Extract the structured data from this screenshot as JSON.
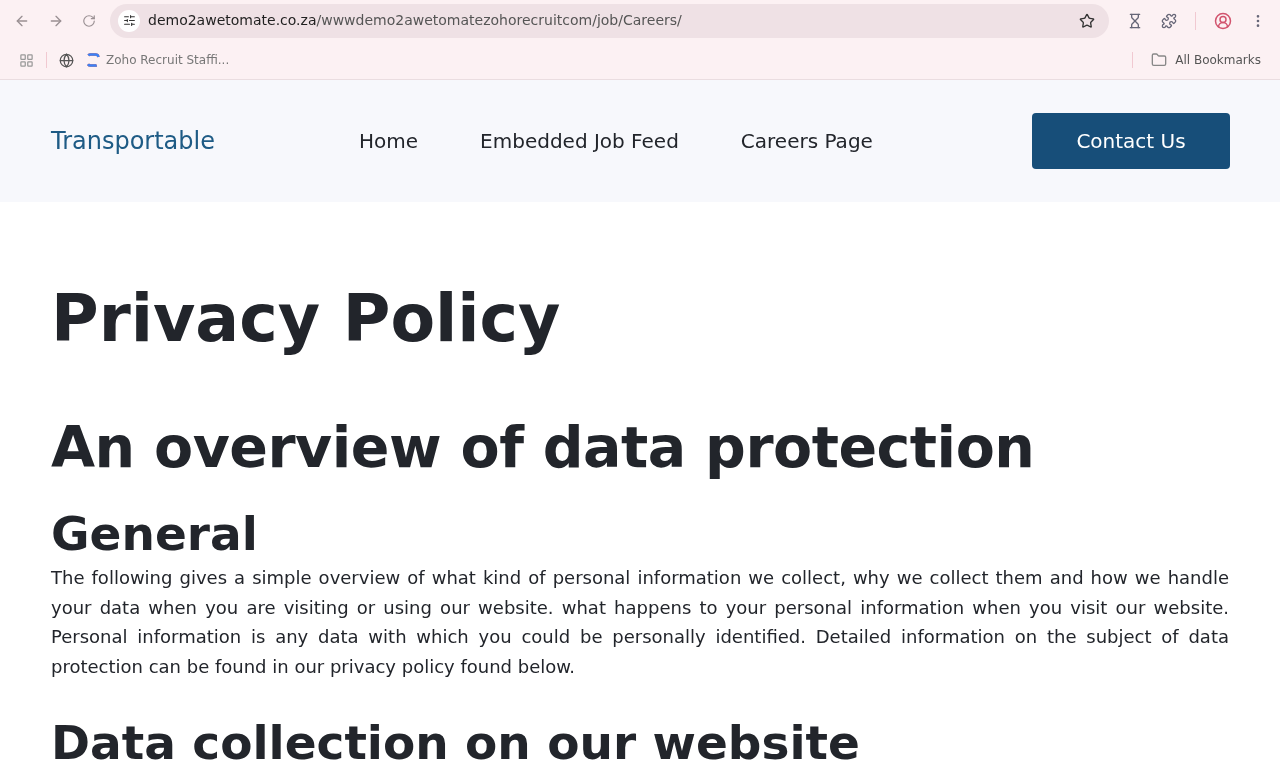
{
  "browser": {
    "url_host": "demo2awetomate.co.za",
    "url_path": "/wwwdemo2awetomatezohorecruitcom/job/Careers/",
    "bookmarks": [
      {
        "label": "Zoho Recruit Staffi..."
      }
    ],
    "all_bookmarks": "All Bookmarks"
  },
  "header": {
    "logo": "Transportable",
    "nav": [
      {
        "label": "Home"
      },
      {
        "label": "Embedded Job Feed"
      },
      {
        "label": "Careers Page"
      }
    ],
    "cta": "Contact Us"
  },
  "content": {
    "title": "Privacy Policy",
    "sections": [
      {
        "kind": "h2",
        "text": "An overview of data protection"
      },
      {
        "kind": "h3",
        "text": "General"
      },
      {
        "kind": "p",
        "text": "The following gives a simple overview of what kind of personal information we collect, why we collect them and how we handle your data when you are visiting or using our website. what happens to your personal information when you visit our website. Personal information is any data with which you could be personally identified. Detailed information on the subject of data protection can be found in our privacy policy found below."
      },
      {
        "kind": "h3",
        "text": "Data collection on our website"
      }
    ]
  }
}
